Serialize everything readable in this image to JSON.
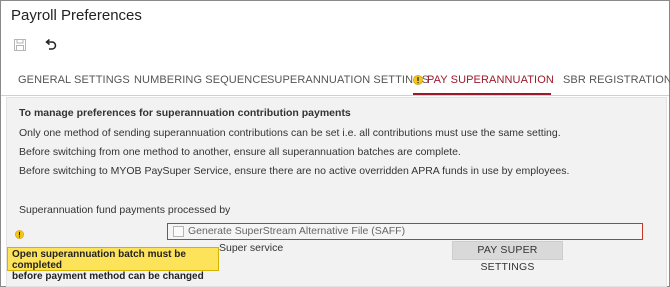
{
  "page": {
    "title": "Payroll Preferences"
  },
  "toolbar": {
    "save_icon": "save-icon",
    "undo_icon": "undo-icon"
  },
  "tabs": [
    {
      "label": "GENERAL SETTINGS",
      "active": false
    },
    {
      "label": "NUMBERING SEQUENCE",
      "active": false
    },
    {
      "label": "SUPERANNUATION SETTINGS",
      "active": false
    },
    {
      "label": "PAY SUPERANNUATION",
      "active": true,
      "icon": "warning-icon"
    },
    {
      "label": "SBR REGISTRATION",
      "active": false
    }
  ],
  "content": {
    "heading": "To manage preferences for superannuation contribution payments",
    "line1": "Only one method of sending superannuation contributions can be set i.e. all contributions must use the same setting.",
    "line2": "Before switching from one method to another, ensure all superannuation batches are complete.",
    "line3": "Before switching to MYOB PaySuper Service, ensure there are no active overridden APRA funds in use by employees.",
    "section_label": "Superannuation fund payments processed by",
    "saff_label": "Generate SuperStream Alternative File (SAFF)",
    "saff_checked": false,
    "paysuper_partial": "Super service",
    "paysuper_button": "PAY SUPER SETTINGS",
    "tooltip_line1": "Open superannuation batch must be completed",
    "tooltip_line2": "before payment method can be changed"
  },
  "colors": {
    "accent": "#9a1a2c",
    "warning": "#f5c518",
    "tooltip_bg": "#fde35a",
    "error_border": "#c0392b"
  }
}
